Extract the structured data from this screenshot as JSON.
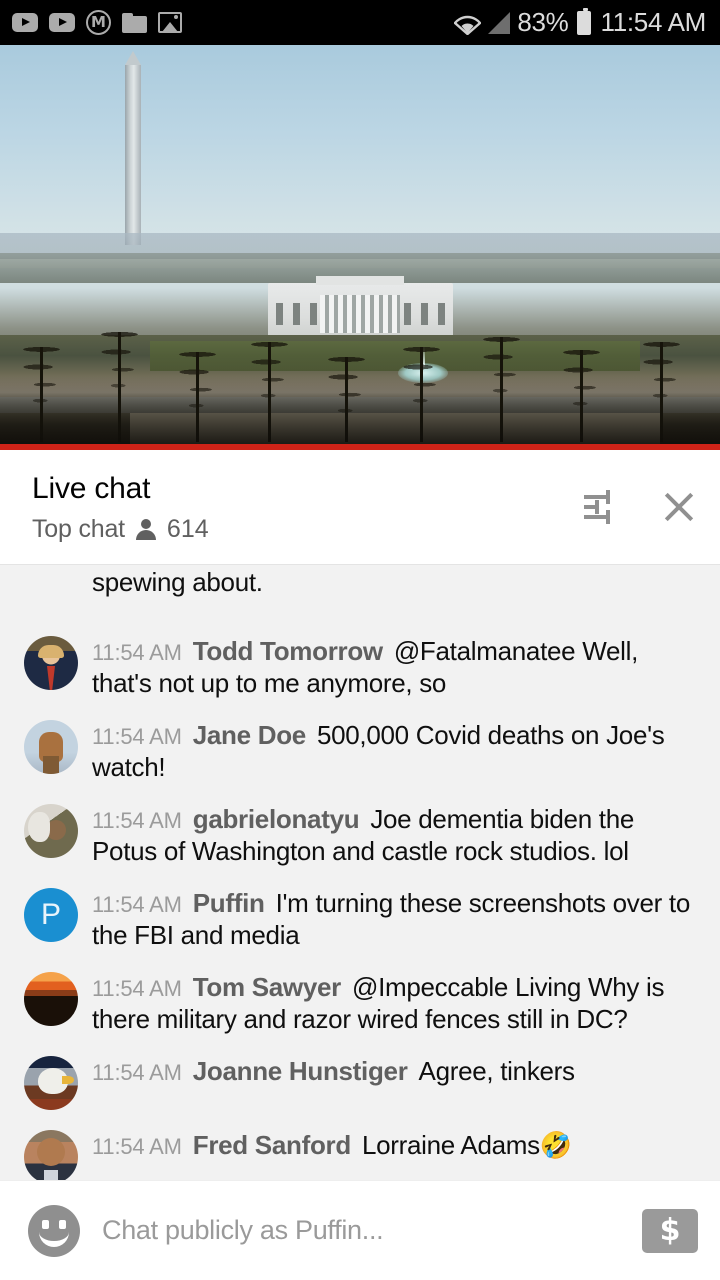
{
  "statusbar": {
    "icons": [
      "youtube-icon",
      "youtube-icon",
      "m-circle-icon",
      "folder-icon",
      "image-icon"
    ],
    "wifi": "wifi-icon",
    "signal": "signal-icon",
    "battery_percent": "83%",
    "battery": "battery-icon",
    "time": "11:54 AM"
  },
  "video": {
    "name": "live-stream-white-house",
    "progress_color": "#cf2318",
    "progress_percent": 100
  },
  "chat_header": {
    "title": "Live chat",
    "mode": "Top chat",
    "viewer_count": "614",
    "viewer_icon": "person-icon",
    "settings_icon": "tune-icon",
    "close_icon": "close-icon"
  },
  "messages": [
    {
      "partial": true,
      "avatar": "none",
      "time": "",
      "author": "",
      "text": "spewing about."
    },
    {
      "partial": false,
      "avatar": "av-trump",
      "time": "11:54 AM",
      "author": "Todd Tomorrow",
      "text": "@Fatalmanatee Well, that's not up to me anymore, so"
    },
    {
      "partial": false,
      "avatar": "av-hand",
      "time": "11:54 AM",
      "author": "Jane Doe",
      "text": "500,000 Covid deaths on Joe's watch!"
    },
    {
      "partial": false,
      "avatar": "av-gabe",
      "time": "11:54 AM",
      "author": "gabrielonatyu",
      "text": "Joe dementia biden the Potus of Washington and castle rock studios. lol"
    },
    {
      "partial": false,
      "avatar": "av-puffin",
      "avatar_letter": "P",
      "avatar_color": "#1a8fd1",
      "time": "11:54 AM",
      "author": "Puffin",
      "text": "I'm turning these screenshots over to the FBI and media"
    },
    {
      "partial": false,
      "avatar": "av-sunset",
      "time": "11:54 AM",
      "author": "Tom Sawyer",
      "text": "@Impeccable Living Why is there military and razor wired fences still in DC?"
    },
    {
      "partial": false,
      "avatar": "av-eagle",
      "time": "11:54 AM",
      "author": "Joanne Hunstiger",
      "text": "Agree, tinkers"
    },
    {
      "partial": false,
      "avatar": "av-fred",
      "time": "11:54 AM",
      "author": "Fred Sanford",
      "text": "Lorraine Adams",
      "emoji": "🤣"
    }
  ],
  "input_bar": {
    "emoji_icon": "smiley-icon",
    "placeholder": "Chat publicly as Puffin...",
    "value": "",
    "superchat_label": "$",
    "superchat_icon": "dollar-icon"
  }
}
